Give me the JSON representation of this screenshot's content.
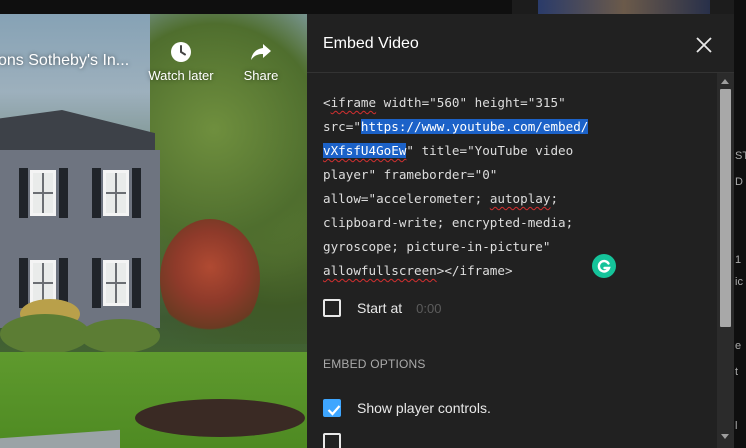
{
  "player": {
    "video_title": "ons Sotheby's In...",
    "watch_later_label": "Watch later",
    "share_label": "Share"
  },
  "side_fragments": [
    "ST",
    "D",
    "1",
    "ic",
    "e",
    "t",
    "l"
  ],
  "dialog": {
    "title": "Embed Video",
    "code": {
      "l1_a": "<",
      "l1_b": "iframe",
      "l1_c": " width=\"560\" height=\"315\"",
      "l2_a": "src=\"",
      "l2_b": "https://www.youtube.com/embed/",
      "l3_a": "vXfsfU4GoEw",
      "l3_b": "\" title=\"YouTube video",
      "l4": "player\" frameborder=\"0\"",
      "l5_a": "allow=\"accelerometer; ",
      "l5_b": "autoplay",
      "l5_c": ";",
      "l6": "clipboard-write; encrypted-media;",
      "l7": "gyroscope; picture-in-picture\"",
      "l8_a": "allowfullscreen",
      "l8_b": "></iframe>"
    },
    "start_at_label": "Start at",
    "start_at_value": "0:00",
    "embed_options_heading": "EMBED OPTIONS",
    "show_controls_label": "Show player controls."
  },
  "colors": {
    "dialog_bg": "#212121",
    "selection": "#1c62c8",
    "checkbox_checked": "#3ea6ff",
    "grammarly": "#15c39a"
  }
}
